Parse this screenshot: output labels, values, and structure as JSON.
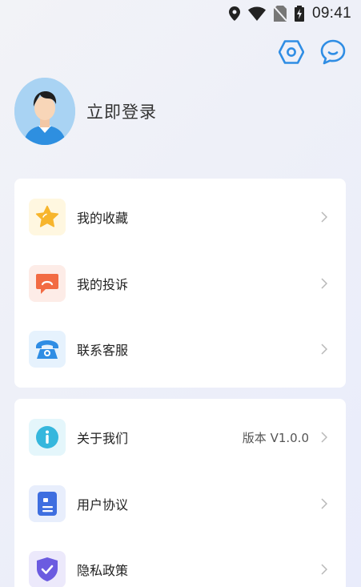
{
  "status_bar": {
    "time": "09:41",
    "icons": [
      "location-icon",
      "wifi-icon",
      "no-sim-icon",
      "battery-charging-icon"
    ]
  },
  "header": {
    "icons": [
      "settings-icon",
      "message-icon"
    ]
  },
  "profile": {
    "login_label": "立即登录"
  },
  "menu_group_1": {
    "items": [
      {
        "label": "我的收藏",
        "icon": "star-icon",
        "icon_bg": "#fff7e0",
        "icon_color": "#f7b52c"
      },
      {
        "label": "我的投诉",
        "icon": "complaint-icon",
        "icon_bg": "#fdece7",
        "icon_color": "#f26b43"
      },
      {
        "label": "联系客服",
        "icon": "phone-icon",
        "icon_bg": "#e6f2fd",
        "icon_color": "#2f8de4"
      }
    ]
  },
  "menu_group_2": {
    "items": [
      {
        "label": "关于我们",
        "icon": "info-icon",
        "icon_bg": "#e4f6fb",
        "icon_color": "#36b7dd",
        "value": "版本 V1.0.0"
      },
      {
        "label": "用户协议",
        "icon": "document-icon",
        "icon_bg": "#e8eefc",
        "icon_color": "#3e6ee0"
      },
      {
        "label": "隐私政策",
        "icon": "shield-check-icon",
        "icon_bg": "#ece9fb",
        "icon_color": "#6b5be0"
      }
    ]
  }
}
